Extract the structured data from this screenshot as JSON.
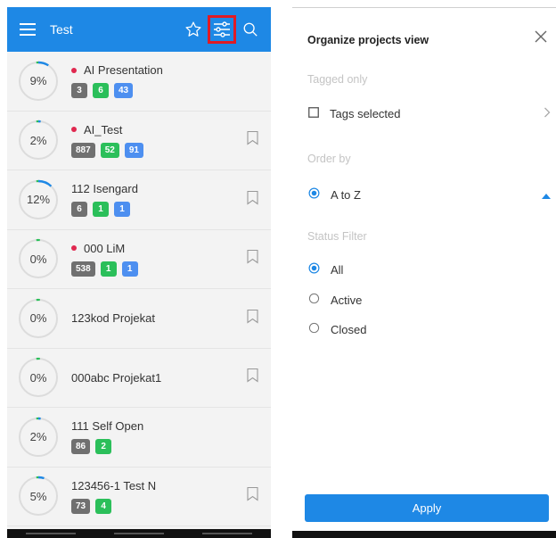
{
  "header": {
    "title": "Test"
  },
  "projects": [
    {
      "percent": "9%",
      "progress": 0.09,
      "name": "AI Presentation",
      "dot": true,
      "badges": [
        "3",
        "6",
        "43"
      ],
      "bookmark": false
    },
    {
      "percent": "2%",
      "progress": 0.02,
      "name": "AI_Test",
      "dot": true,
      "badges": [
        "887",
        "52",
        "91"
      ],
      "bookmark": true
    },
    {
      "percent": "12%",
      "progress": 0.12,
      "name": "112 Isengard",
      "dot": false,
      "badges": [
        "6",
        "1",
        "1"
      ],
      "bookmark": true
    },
    {
      "percent": "0%",
      "progress": 0.0,
      "name": "000 LiM",
      "dot": true,
      "badges": [
        "538",
        "1",
        "1"
      ],
      "bookmark": true
    },
    {
      "percent": "0%",
      "progress": 0.0,
      "name": "123kod Projekat",
      "dot": false,
      "badges": [],
      "bookmark": true
    },
    {
      "percent": "0%",
      "progress": 0.0,
      "name": "000abc Projekat1",
      "dot": false,
      "badges": [],
      "bookmark": true
    },
    {
      "percent": "2%",
      "progress": 0.02,
      "name": "111 Self Open",
      "dot": false,
      "badges": [
        "86",
        "2"
      ],
      "bookmark": false
    },
    {
      "percent": "5%",
      "progress": 0.05,
      "name": "123456-1 Test N",
      "dot": false,
      "badges": [
        "73",
        "4"
      ],
      "bookmark": true
    }
  ],
  "panel": {
    "title": "Organize projects view",
    "tagged_header": "Tagged only",
    "tags_label": "Tags selected",
    "order_header": "Order by",
    "order_value": "A to Z",
    "status_header": "Status Filter",
    "status_options": [
      "All",
      "Active",
      "Closed"
    ],
    "status_selected": "All",
    "apply_label": "Apply"
  },
  "colors": {
    "accent": "#1e88e5",
    "badge_grey": "#707070",
    "badge_green": "#2bbf5a",
    "badge_blue": "#4d8ff0",
    "dot_red": "#e0284f",
    "highlight": "#e01b24"
  },
  "icons": {
    "menu": "menu-icon",
    "star": "star-icon",
    "filter": "filter-sliders-icon",
    "search": "search-icon",
    "bookmark": "bookmark-icon",
    "close": "close-icon",
    "chevron_right": "chevron-right-icon",
    "caret_up": "caret-up-icon"
  }
}
